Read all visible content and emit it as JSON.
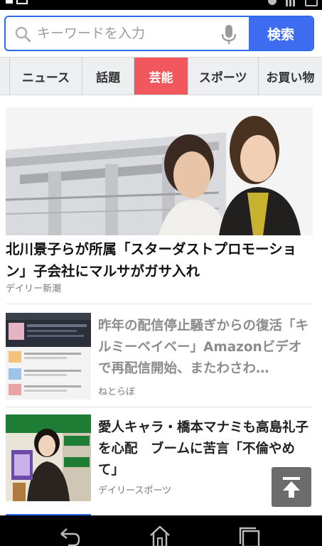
{
  "search": {
    "placeholder": "キーワードを入力",
    "button_label": "検索"
  },
  "tabs": [
    {
      "label": "ニュース",
      "active": false
    },
    {
      "label": "話題",
      "active": false
    },
    {
      "label": "芸能",
      "active": true
    },
    {
      "label": "スポーツ",
      "active": false
    },
    {
      "label": "お買い物",
      "active": false
    }
  ],
  "hero": {
    "title": "北川景子らが所属「スターダストプロモーション」子会社にマルサがガサ入れ",
    "source": "デイリー新潮"
  },
  "articles": [
    {
      "title": "昨年の配信停止騒ぎからの復活「キルミーベイベー」Amazonビデオで再配信開始、またわさわ…",
      "source": "ねとらぼ",
      "read": true
    },
    {
      "title": "愛人キャラ・橋本マナミも高島礼子を心配　ブームに苦言「不倫やめて」",
      "source": "デイリースポーツ",
      "read": false
    }
  ],
  "colors": {
    "accent": "#3d6cf0",
    "active_tab": "#f0585d"
  }
}
